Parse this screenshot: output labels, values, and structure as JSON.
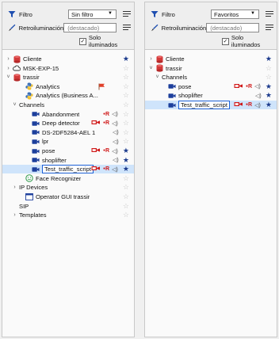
{
  "panels": [
    {
      "filter_label": "Filtro",
      "filter_value": "Sin filtro",
      "backlight_label": "Retroiluminación",
      "backlight_value": "(destacado)",
      "only_lit_label": "Solo iluminados",
      "only_lit_checked": true,
      "rows": [
        {
          "label": "Cliente",
          "icon": "database-icon",
          "arrow": "›",
          "star": true
        },
        {
          "label": "MSK-EXP-15",
          "icon": "cloud-icon",
          "arrow": "›",
          "star": false
        },
        {
          "label": "trassir",
          "icon": "database-icon",
          "arrow": "˅",
          "star": false
        },
        {
          "label": "Analytics",
          "icon": "python-icon",
          "arrow": "",
          "star": false,
          "flag": true
        },
        {
          "label": "Analytics (Business A...",
          "icon": "python-icon",
          "arrow": "",
          "star": false
        },
        {
          "label": "Channels",
          "icon": "",
          "arrow": "˅",
          "star": false
        },
        {
          "label": "Abandonment",
          "icon": "camera-icon",
          "arrow": "",
          "star": false,
          "rec": true,
          "cam": false,
          "spk": true
        },
        {
          "label": "Deep detector",
          "icon": "camera-icon",
          "arrow": "",
          "star": false,
          "rec": true,
          "cam": true,
          "spk": true
        },
        {
          "label": "DS-2DF5284-AEL 1",
          "icon": "camera-icon",
          "arrow": "",
          "star": false,
          "rec": false,
          "cam": false,
          "spk": true
        },
        {
          "label": "lpr",
          "icon": "camera-icon",
          "arrow": "",
          "star": false,
          "rec": false,
          "cam": false,
          "spk": true
        },
        {
          "label": "pose",
          "icon": "camera-icon",
          "arrow": "",
          "star": true,
          "rec": true,
          "cam": true,
          "spk": true
        },
        {
          "label": "shoplifter",
          "icon": "camera-icon",
          "arrow": "",
          "star": true,
          "rec": false,
          "cam": false,
          "spk": true
        },
        {
          "label": "Test_traffic_script",
          "icon": "camera-icon",
          "arrow": "",
          "star": true,
          "rec": true,
          "cam": true,
          "spk": true,
          "selected": true
        },
        {
          "label": "Face Recognizer",
          "icon": "face-icon",
          "arrow": "",
          "star": false
        },
        {
          "label": "IP Devices",
          "icon": "",
          "arrow": "›",
          "star": false
        },
        {
          "label": "Operator GUI trassir",
          "icon": "window-icon",
          "arrow": "",
          "star": false
        },
        {
          "label": "SIP",
          "icon": "",
          "arrow": "",
          "star": false
        },
        {
          "label": "Templates",
          "icon": "",
          "arrow": "›",
          "star": false
        }
      ]
    },
    {
      "filter_label": "Filtro",
      "filter_value": "Favoritos",
      "backlight_label": "Retroiluminación",
      "backlight_value": "(destacado)",
      "only_lit_label": "Solo iluminados",
      "only_lit_checked": true,
      "rows": [
        {
          "label": "Cliente",
          "icon": "database-icon",
          "arrow": "›",
          "star": true
        },
        {
          "label": "trassir",
          "icon": "database-icon",
          "arrow": "˅",
          "star": false
        },
        {
          "label": "Channels",
          "icon": "",
          "arrow": "˅",
          "star": false
        },
        {
          "label": "pose",
          "icon": "camera-icon",
          "arrow": "",
          "star": true,
          "rec": true,
          "cam": true,
          "spk": true
        },
        {
          "label": "shoplifter",
          "icon": "camera-icon",
          "arrow": "",
          "star": true,
          "rec": false,
          "cam": false,
          "spk": true
        },
        {
          "label": "Test_traffic_script",
          "icon": "camera-icon",
          "arrow": "",
          "star": true,
          "rec": true,
          "cam": true,
          "spk": true,
          "selected": true
        }
      ]
    }
  ],
  "colors": {
    "accent": "#1a5fd6",
    "star_on": "#1b3a8c",
    "star_off": "#c6c6c6",
    "record": "#d01818",
    "selection": "#cfe4fb"
  }
}
